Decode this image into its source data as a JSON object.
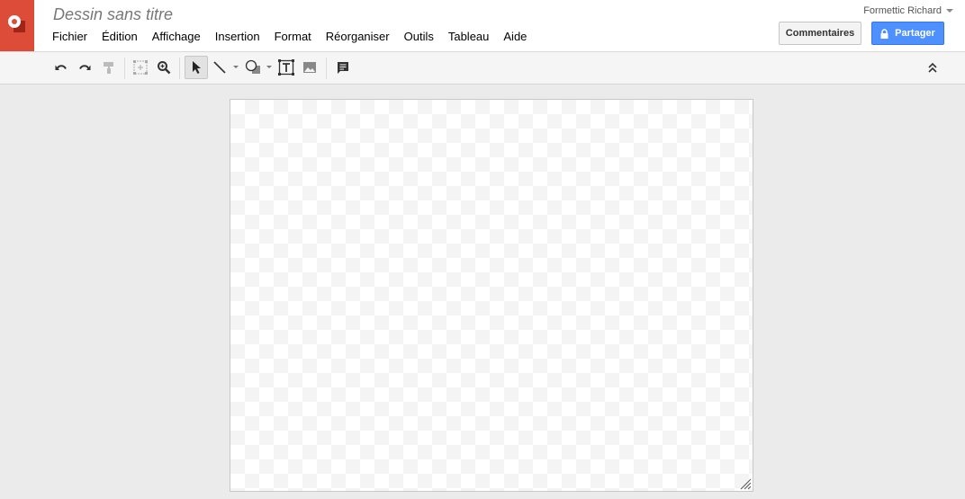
{
  "app": {
    "logo": "drawings-logo-icon"
  },
  "document": {
    "title": "Dessin sans titre"
  },
  "menu": [
    "Fichier",
    "Édition",
    "Affichage",
    "Insertion",
    "Format",
    "Réorganiser",
    "Outils",
    "Tableau",
    "Aide"
  ],
  "user": {
    "name": "Formettic Richard"
  },
  "buttons": {
    "comments": "Commentaires",
    "share": "Partager"
  },
  "toolbar": {
    "tools": [
      "undo-icon",
      "redo-icon",
      "paint-format-icon",
      "zoom-fit-icon",
      "zoom-icon",
      "select-icon",
      "line-icon",
      "shape-icon",
      "text-box-icon",
      "image-icon",
      "comment-icon",
      "collapse-icon"
    ],
    "active_tool": "select-icon"
  },
  "colors": {
    "brand": "#dd4b39",
    "share_button": "#4d90fe",
    "canvas_border": "#c8c8c8"
  }
}
